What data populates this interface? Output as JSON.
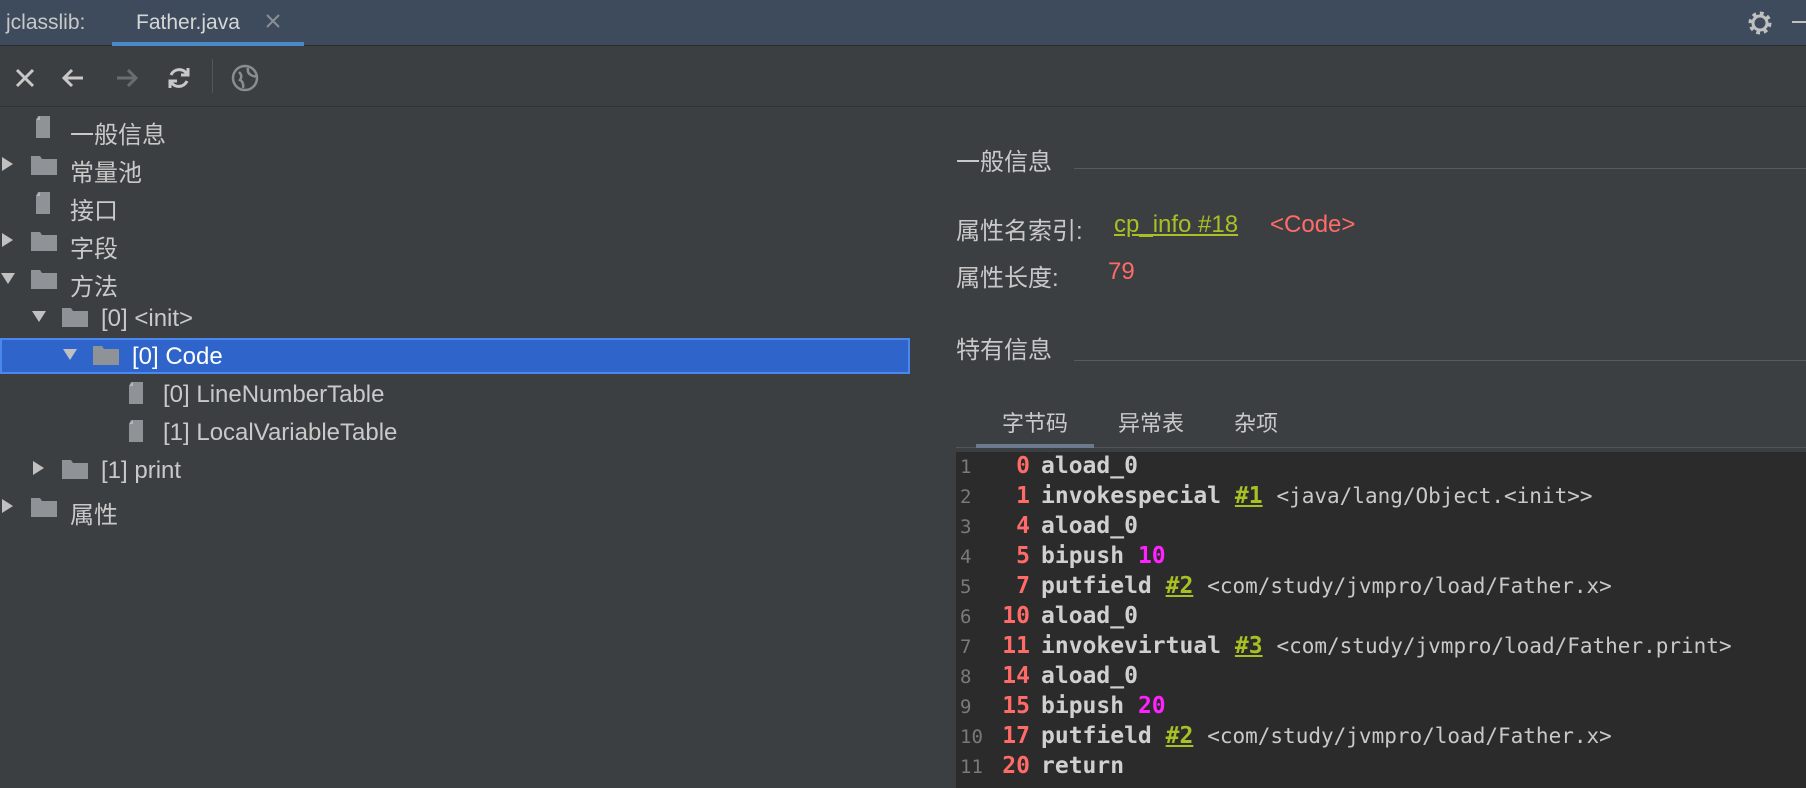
{
  "tabbar": {
    "app_label": "jclasslib:",
    "file_tab": "Father.java"
  },
  "tree": [
    {
      "label": "一般信息",
      "depth": 0,
      "arrow": "none",
      "icon": "file-icon"
    },
    {
      "label": "常量池",
      "depth": 0,
      "arrow": "collapsed",
      "icon": "folder-icon"
    },
    {
      "label": "接口",
      "depth": 0,
      "arrow": "none",
      "icon": "file-icon"
    },
    {
      "label": "字段",
      "depth": 0,
      "arrow": "collapsed",
      "icon": "folder-icon"
    },
    {
      "label": "方法",
      "depth": 0,
      "arrow": "expanded",
      "icon": "folder-icon"
    },
    {
      "label": "[0] <init>",
      "depth": 1,
      "arrow": "expanded",
      "icon": "folder-icon"
    },
    {
      "label": "[0] Code",
      "depth": 2,
      "arrow": "expanded",
      "icon": "folder-icon",
      "selected": true
    },
    {
      "label": "[0] LineNumberTable",
      "depth": 3,
      "arrow": "none",
      "icon": "file-icon"
    },
    {
      "label": "[1] LocalVariableTable",
      "depth": 3,
      "arrow": "none",
      "icon": "file-icon"
    },
    {
      "label": "[1] print",
      "depth": 1,
      "arrow": "collapsed",
      "icon": "folder-icon"
    },
    {
      "label": "属性",
      "depth": 0,
      "arrow": "collapsed",
      "icon": "folder-icon"
    }
  ],
  "general": {
    "title": "一般信息",
    "attr_name_label": "属性名索引:",
    "attr_name_link": "cp_info #18",
    "attr_name_ref": "<Code>",
    "attr_len_label": "属性长度:",
    "attr_len_value": "79"
  },
  "specific": {
    "title": "特有信息"
  },
  "subtabs": [
    "字节码",
    "异常表",
    "杂项"
  ],
  "colors": {
    "selection": "#2f65ca",
    "link": "#a8c023",
    "offset": "#ff6b68",
    "number": "#ff22ff"
  },
  "code": [
    {
      "line": "1",
      "offset": "0",
      "op": "aload_0"
    },
    {
      "line": "2",
      "offset": "1",
      "op": "invokespecial",
      "ref": "#1",
      "comment": "<java/lang/Object.<init>>"
    },
    {
      "line": "3",
      "offset": "4",
      "op": "aload_0"
    },
    {
      "line": "4",
      "offset": "5",
      "op": "bipush",
      "num": "10"
    },
    {
      "line": "5",
      "offset": "7",
      "op": "putfield",
      "ref": "#2",
      "comment": "<com/study/jvmpro/load/Father.x>"
    },
    {
      "line": "6",
      "offset": "10",
      "op": "aload_0"
    },
    {
      "line": "7",
      "offset": "11",
      "op": "invokevirtual",
      "ref": "#3",
      "comment": "<com/study/jvmpro/load/Father.print>"
    },
    {
      "line": "8",
      "offset": "14",
      "op": "aload_0"
    },
    {
      "line": "9",
      "offset": "15",
      "op": "bipush",
      "num": "20"
    },
    {
      "line": "10",
      "offset": "17",
      "op": "putfield",
      "ref": "#2",
      "comment": "<com/study/jvmpro/load/Father.x>"
    },
    {
      "line": "11",
      "offset": "20",
      "op": "return"
    }
  ]
}
